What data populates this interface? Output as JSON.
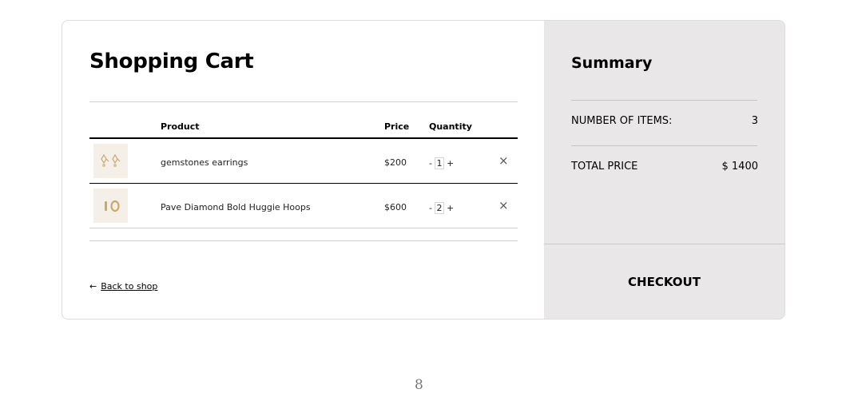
{
  "cart": {
    "title": "Shopping Cart",
    "columns": {
      "product": "Product",
      "price": "Price",
      "quantity": "Quantity"
    },
    "items": [
      {
        "name": "gemstones earrings",
        "price": "$200",
        "quantity": "1",
        "decrement": "-",
        "increment": "+",
        "remove": "×",
        "icon": "earrings-thumbnail"
      },
      {
        "name": "Pave Diamond Bold Huggie Hoops",
        "price": "$600",
        "quantity": "2",
        "decrement": "-",
        "increment": "+",
        "remove": "×",
        "icon": "hoops-thumbnail"
      }
    ],
    "back_arrow": "←",
    "back_label": "Back to shop"
  },
  "summary": {
    "title": "Summary",
    "items_label": "NUMBER OF ITEMS:",
    "items_value": "3",
    "total_label": "TOTAL PRICE",
    "total_value": "$ 1400",
    "checkout_label": "CHECKOUT"
  },
  "page": {
    "number": "8"
  },
  "colors": {
    "summary_bg": "#e9e7e7",
    "thumb_bg": "#f4efe7",
    "accent_gold": "#c9a96a"
  }
}
